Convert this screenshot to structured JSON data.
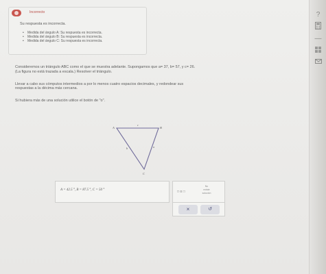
{
  "feedback": {
    "title": "Incorrecto",
    "message": "Su respuesta es incorrecta.",
    "items": [
      "Medida del ángulo A: Su respuesta es incorrecta.",
      "Medida del ángulo B: Su respuesta es incorrecta.",
      "Medida del ángulo C: Su respuesta es incorrecta."
    ]
  },
  "problem": {
    "line1": "Consideremos un triángulo ABC como el que se muestra adelante. Supongamos que a= 37, b= 57, y c= 26.",
    "line2": "(La figura no está trazada a escala.) Resolver el triángulo.",
    "line3": "Llevar a cabo sus cómputos intermedios a por lo menos cuatro espacios decimales, y redondear sus",
    "line4": "respuestas a la décima más cercana.",
    "line5": "Si hubiera más de una solución utilice el botón de \"o\"."
  },
  "figure": {
    "vertex_a": "A",
    "vertex_b": "B",
    "vertex_c": "C",
    "side_c": "c",
    "side_b": "b",
    "side_a": "a"
  },
  "answer": {
    "text": "A = 42.5 °,  B = 87.5 °,  C = 50 °"
  },
  "options": {
    "or_label": "□ o □",
    "no_solution_line1": "No",
    "no_solution_line2": "existe",
    "no_solution_line3": "solución"
  },
  "buttons": {
    "clear": "×",
    "undo": "↺"
  },
  "sidebar": {
    "help_icon": "?",
    "calculator_icon": "calculator-icon",
    "dash_icon": "—",
    "grid_icon": "grid-icon",
    "mail_icon": "mail-icon"
  }
}
